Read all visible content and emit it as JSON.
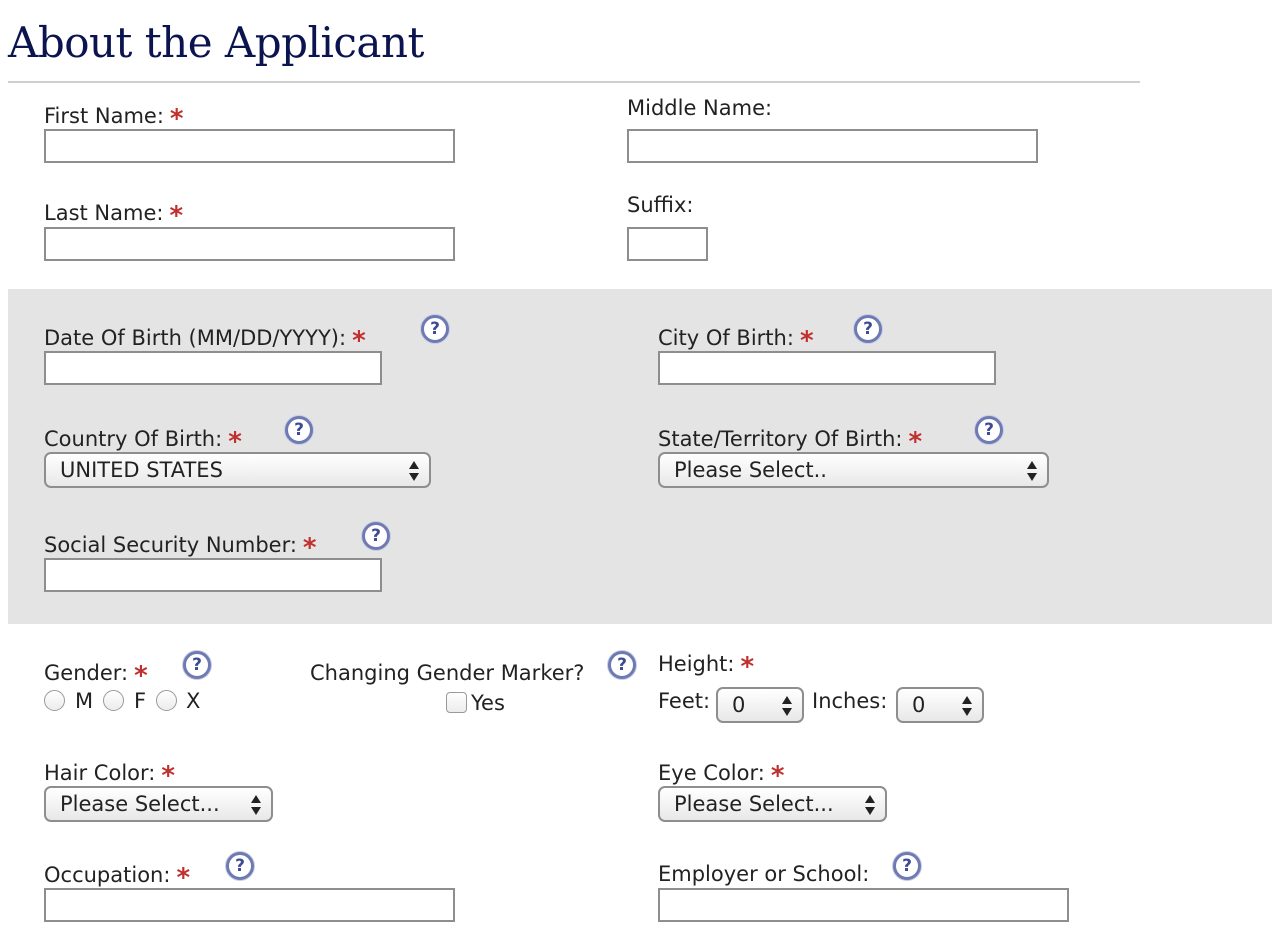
{
  "page": {
    "title": "About the Applicant"
  },
  "required_mark": "*",
  "help_icon": "question-circle-icon",
  "colors": {
    "title": "#0c1450",
    "required": "#c0302e",
    "band": "#e4e4e4",
    "help": "#6e7ab2"
  },
  "fields": {
    "first_name": {
      "label": "First Name:",
      "value": ""
    },
    "middle_name": {
      "label": "Middle Name:",
      "value": ""
    },
    "last_name": {
      "label": "Last Name:",
      "value": ""
    },
    "suffix": {
      "label": "Suffix:",
      "value": ""
    },
    "date_of_birth": {
      "label": "Date Of Birth (MM/DD/YYYY):",
      "value": ""
    },
    "city_of_birth": {
      "label": "City Of Birth:",
      "value": ""
    },
    "country_of_birth": {
      "label": "Country Of Birth:",
      "selected": "UNITED STATES"
    },
    "state_of_birth": {
      "label": "State/Territory Of Birth:",
      "selected": "Please Select.."
    },
    "ssn": {
      "label": "Social Security Number:",
      "value": ""
    },
    "gender": {
      "label": "Gender:",
      "options": [
        "M",
        "F",
        "X"
      ]
    },
    "gender_marker": {
      "label": "Changing Gender Marker?",
      "option": "Yes"
    },
    "height": {
      "label": "Height:",
      "feet_label": "Feet:",
      "feet_value": "0",
      "inches_label": "Inches:",
      "inches_value": "0"
    },
    "hair_color": {
      "label": "Hair Color:",
      "selected": "Please Select..."
    },
    "eye_color": {
      "label": "Eye Color:",
      "selected": "Please Select..."
    },
    "occupation": {
      "label": "Occupation:",
      "value": ""
    },
    "employer": {
      "label": "Employer or School:",
      "value": ""
    }
  }
}
